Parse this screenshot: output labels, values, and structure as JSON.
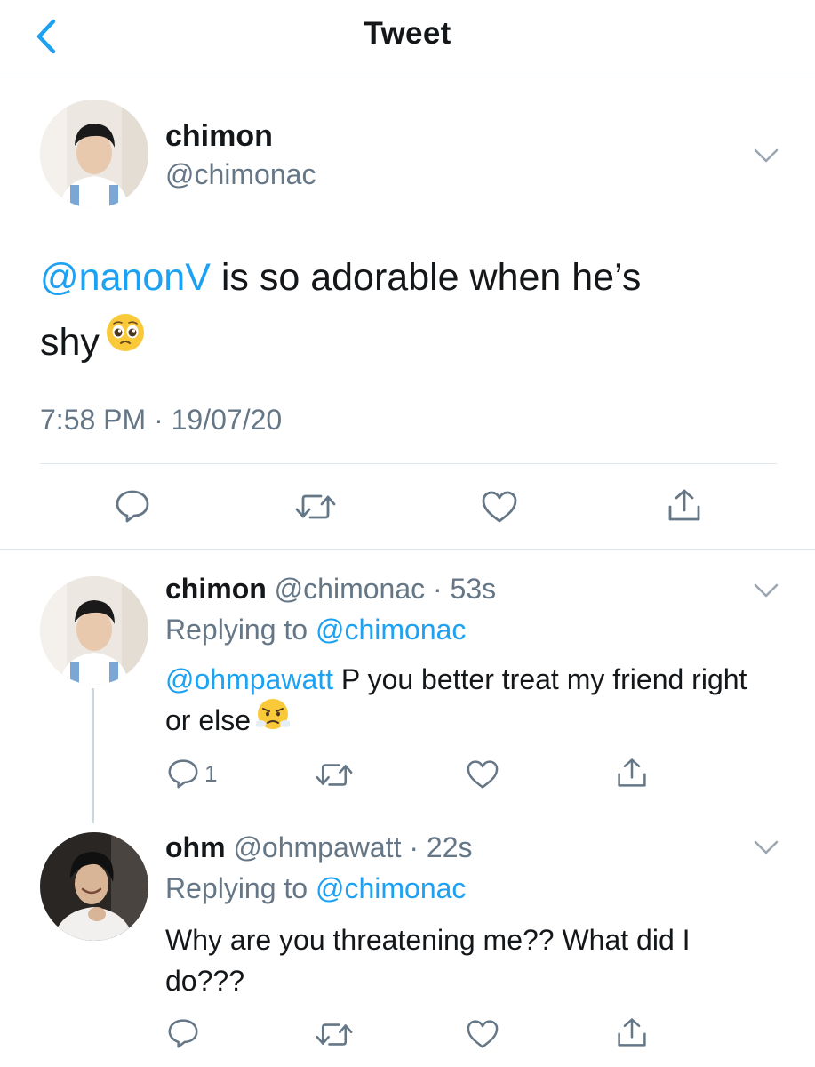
{
  "header": {
    "title": "Tweet",
    "back_icon": "chevron-left-icon",
    "accent": "#1da1f2"
  },
  "main_tweet": {
    "display_name": "chimon",
    "handle": "@chimonac",
    "mention": "@nanonV",
    "text": " is so adorable when he’s shy",
    "emoji": "pleading-face-emoji",
    "timestamp": "7:58 PM · 19/07/20",
    "actions": [
      "reply-icon",
      "retweet-icon",
      "like-icon",
      "share-icon"
    ]
  },
  "replies": [
    {
      "display_name": "chimon",
      "meta": "@chimonac · 53s",
      "replying_label": "Replying to ",
      "replying_to": "@chimonac",
      "mention": "@ohmpawatt",
      "text": " P you better treat my friend right or else",
      "emoji": "face-with-steam-emoji",
      "reply_count": "1"
    },
    {
      "display_name": "ohm",
      "meta": "@ohmpawatt · 22s",
      "replying_label": "Replying to ",
      "replying_to": "@chimonac",
      "text": "Why are you threatening me?? What did I do???"
    }
  ]
}
